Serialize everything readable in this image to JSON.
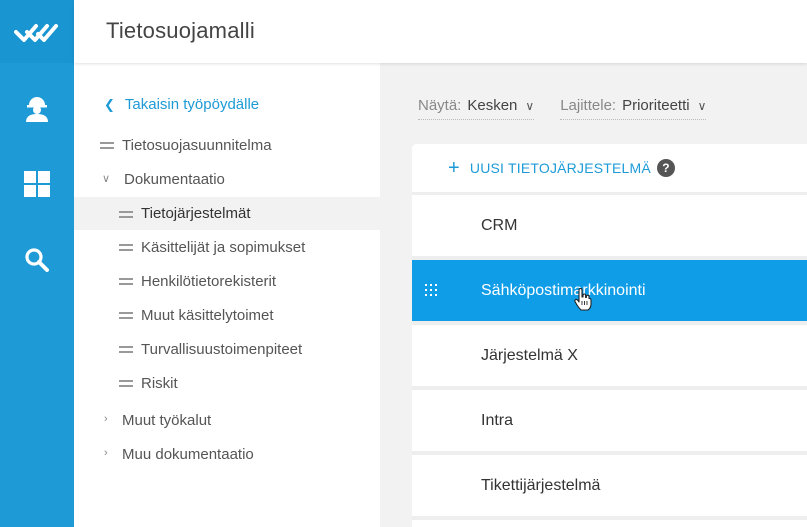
{
  "header": {
    "title": "Tietosuojamalli"
  },
  "rail": {
    "items": [
      {
        "icon": "logo-icon"
      },
      {
        "icon": "worker-icon"
      },
      {
        "icon": "dashboard-icon"
      },
      {
        "icon": "search-icon"
      }
    ],
    "colors": {
      "background": "#1e9bd7"
    }
  },
  "sidebar": {
    "back_label": "Takaisin työpöydälle",
    "items": [
      {
        "label": "Tietosuojasuunnitelma",
        "icon": "equals-icon"
      },
      {
        "label": "Dokumentaatio",
        "icon": "chevron-down-icon"
      },
      {
        "label": "Tietojärjestelmät",
        "icon": "equals-icon"
      },
      {
        "label": "Käsittelijät ja sopimukset",
        "icon": "equals-icon"
      },
      {
        "label": "Henkilötietorekisterit",
        "icon": "equals-icon"
      },
      {
        "label": "Muut käsittelytoimet",
        "icon": "equals-icon"
      },
      {
        "label": "Turvallisuustoimenpiteet",
        "icon": "equals-icon"
      },
      {
        "label": "Riskit",
        "icon": "equals-icon"
      },
      {
        "label": "Muut työkalut",
        "icon": "chevron-right-icon"
      },
      {
        "label": "Muu dokumentaatio",
        "icon": "chevron-right-icon"
      }
    ]
  },
  "toolbar": {
    "show_label": "Näytä:",
    "show_value": "Kesken",
    "sort_label": "Lajittele:",
    "sort_value": "Prioriteetti"
  },
  "list": {
    "new_label": "UUSI TIETOJÄRJESTELMÄ",
    "help_symbol": "?",
    "rows": [
      {
        "name": "CRM"
      },
      {
        "name": "Sähköpostimarkkinointi"
      },
      {
        "name": "Järjestelmä X"
      },
      {
        "name": "Intra"
      },
      {
        "name": "Tikettijärjestelmä"
      }
    ],
    "selected_color": "#0f9de8"
  }
}
